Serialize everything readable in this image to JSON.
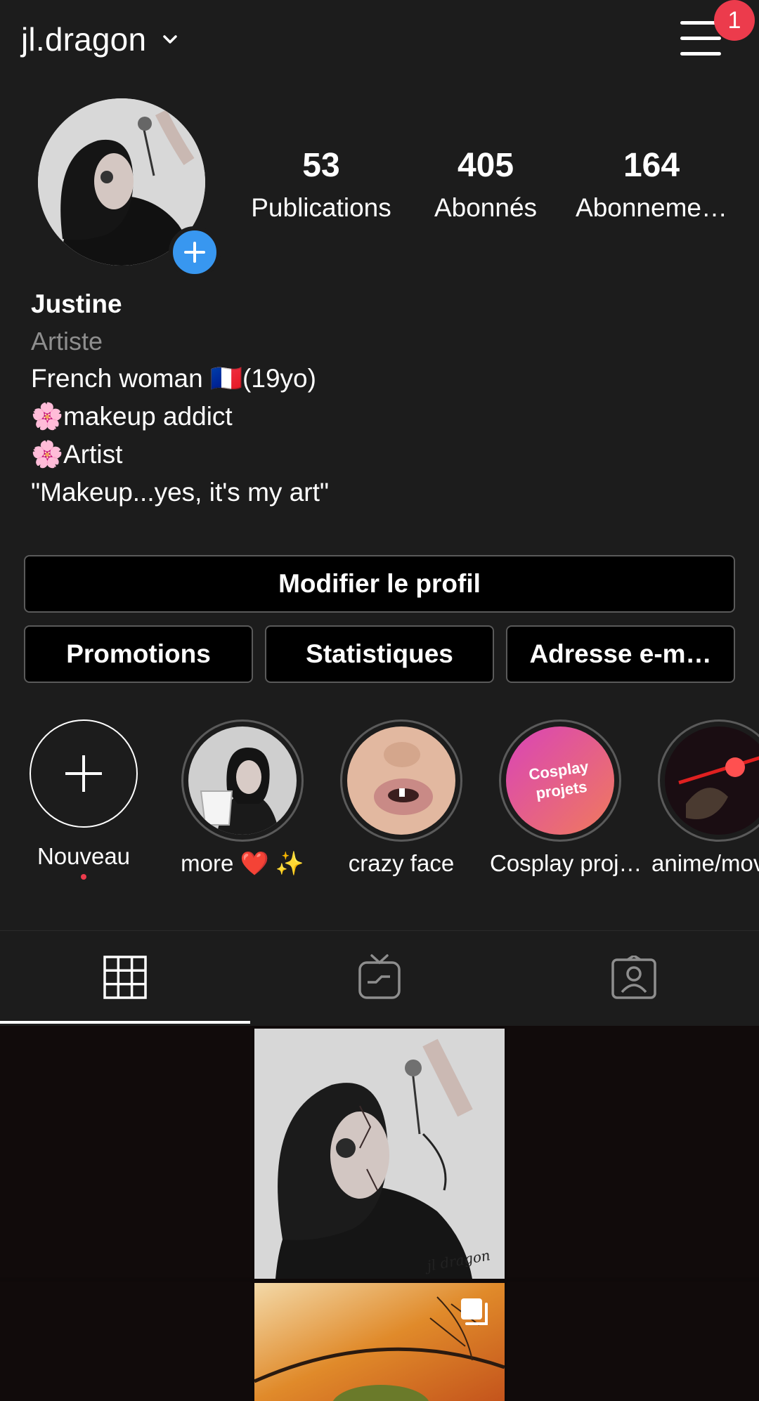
{
  "header": {
    "username": "jl.dragon",
    "notification_count": "1"
  },
  "stats": [
    {
      "number": "53",
      "label": "Publications"
    },
    {
      "number": "405",
      "label": "Abonnés"
    },
    {
      "number": "164",
      "label": "Abonneme…"
    }
  ],
  "bio": {
    "name": "Justine",
    "category": "Artiste",
    "lines": [
      "French  woman 🇫🇷(19yo)",
      "🌸makeup addict",
      "🌸Artist",
      "\"Makeup...yes, it's my art\""
    ]
  },
  "buttons": {
    "edit_profile": "Modifier le profil",
    "promotions": "Promotions",
    "insights": "Statistiques",
    "email": "Adresse e-m…"
  },
  "highlights": [
    {
      "label": "Nouveau"
    },
    {
      "label": "more ❤️ ✨"
    },
    {
      "label": "crazy face"
    },
    {
      "label": "Cosplay proj…",
      "cover_text": "Cosplay projets"
    },
    {
      "label": "anime/mov"
    }
  ],
  "post_watermark": "jl dragon",
  "colors": {
    "background": "#1c1c1c",
    "accent_blue": "#3897f0",
    "badge_red": "#ec3b4c"
  },
  "icons": {
    "tabs": [
      "grid-icon",
      "igtv-icon",
      "tagged-icon"
    ],
    "header": [
      "chevron-down-icon",
      "menu-icon"
    ]
  }
}
